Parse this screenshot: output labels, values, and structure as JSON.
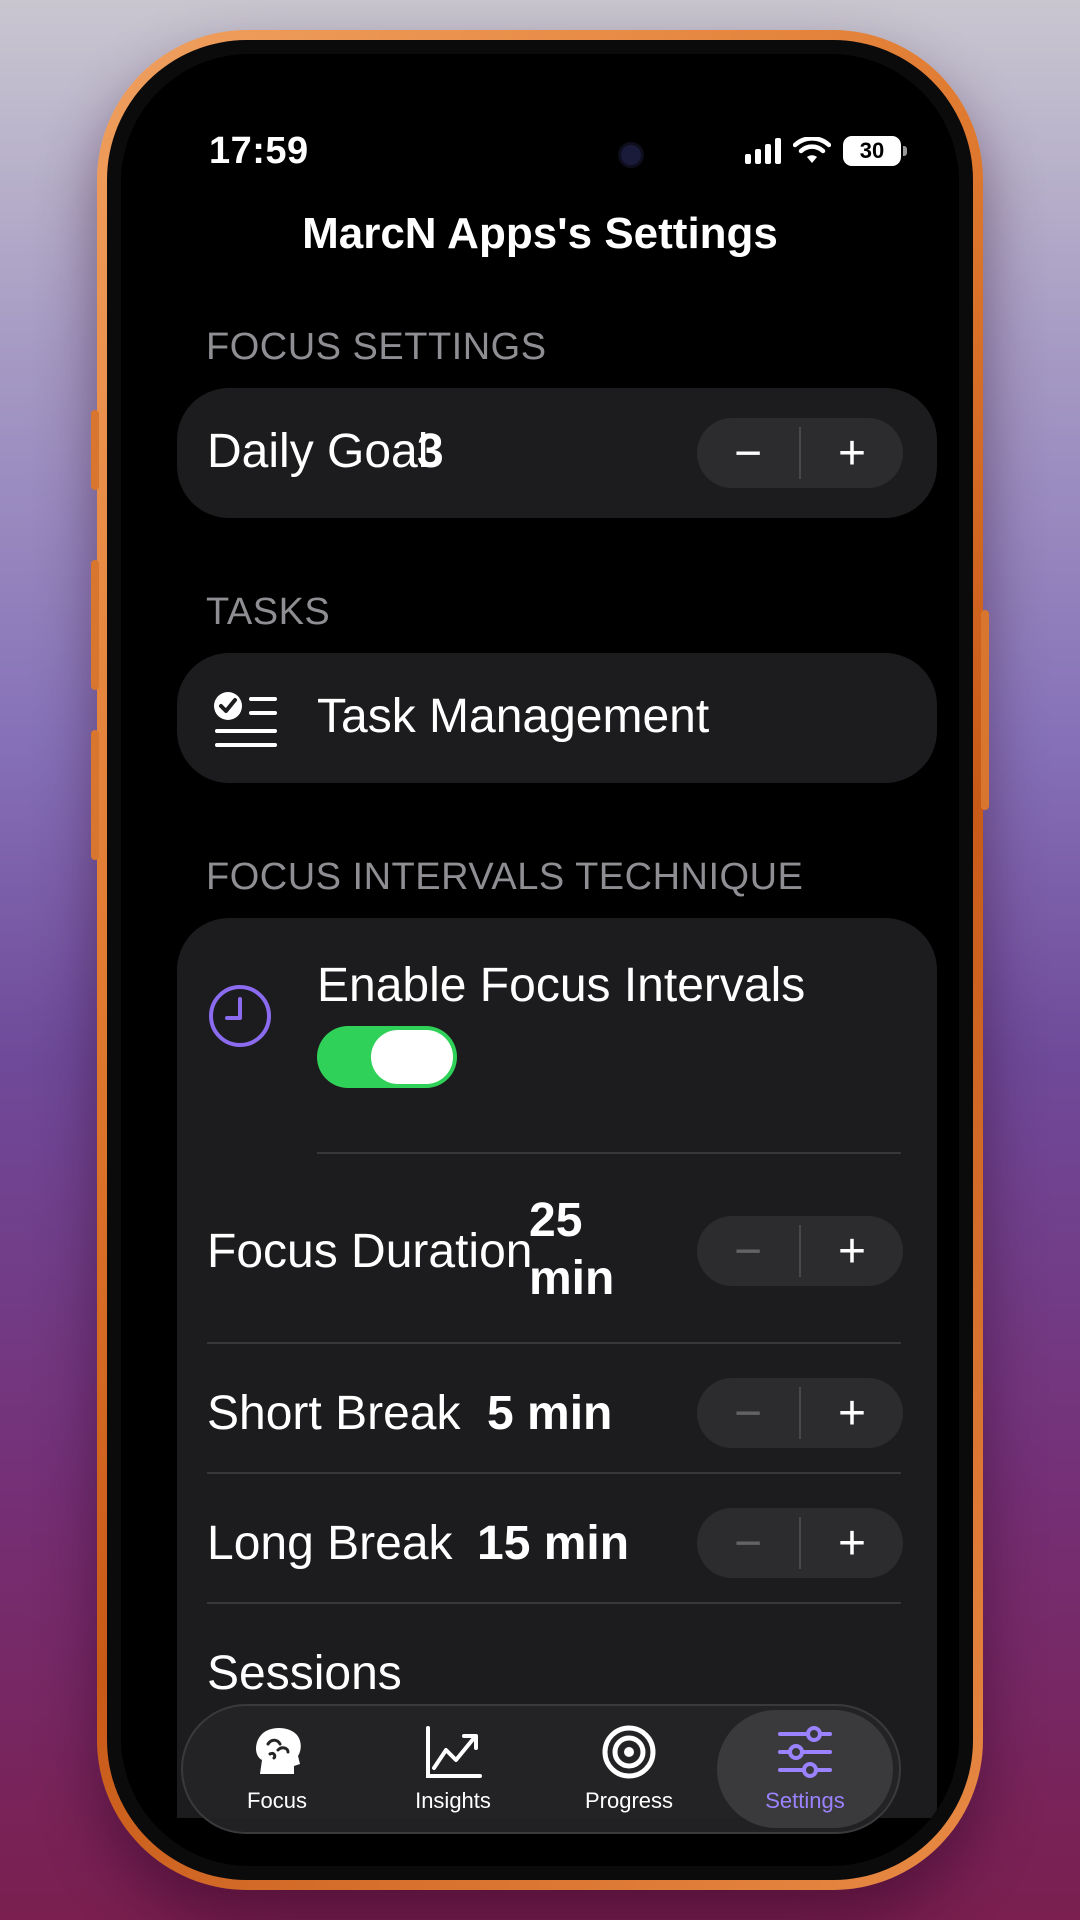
{
  "status_bar": {
    "time": "17:59",
    "battery": "30"
  },
  "header": {
    "title": "MarcN Apps's Settings"
  },
  "focus_settings": {
    "section_label": "FOCUS SETTINGS",
    "daily_goal": {
      "label": "Daily Goal",
      "value": "3",
      "minus": "−",
      "plus": "+"
    }
  },
  "tasks": {
    "section_label": "TASKS",
    "task_management": {
      "label": "Task Management",
      "icon": "checklist-icon"
    }
  },
  "intervals": {
    "section_label": "FOCUS INTERVALS TECHNIQUE",
    "enable": {
      "label": "Enable Focus Intervals",
      "icon": "clock-icon",
      "on": true
    },
    "focus_duration": {
      "label": "Focus Duration",
      "value_line1": "25",
      "value_line2": "min",
      "minus": "−",
      "plus": "+"
    },
    "short_break": {
      "label": "Short Break",
      "value": "5 min",
      "minus": "−",
      "plus": "+"
    },
    "long_break": {
      "label": "Long Break",
      "value": "15 min",
      "minus": "−",
      "plus": "+"
    },
    "sessions": {
      "label": "Sessions"
    }
  },
  "tab_bar": {
    "tabs": [
      {
        "label": "Focus",
        "icon": "brain-head-icon"
      },
      {
        "label": "Insights",
        "icon": "chart-icon"
      },
      {
        "label": "Progress",
        "icon": "target-icon"
      },
      {
        "label": "Settings",
        "icon": "sliders-icon",
        "active": true
      }
    ]
  },
  "colors": {
    "accent": "#9b82ff",
    "toggle_on": "#30d158",
    "card": "#1c1c1e",
    "frame": "#e07a30"
  }
}
